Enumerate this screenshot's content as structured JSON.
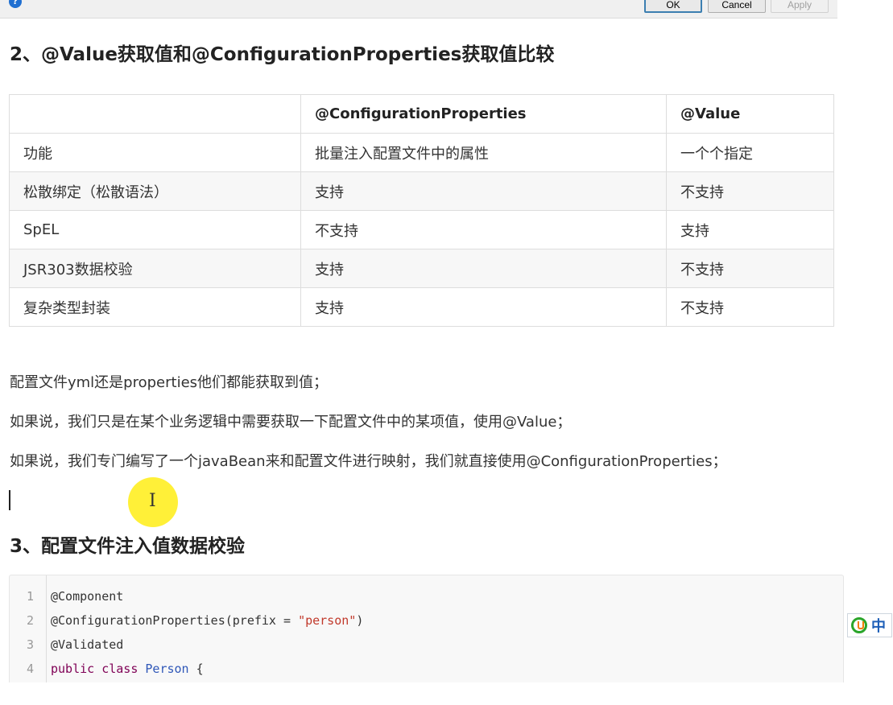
{
  "dialog": {
    "ok_label": "OK",
    "cancel_label": "Cancel",
    "apply_label": "Apply"
  },
  "section2": {
    "heading": "2、@Value获取值和@ConfigurationProperties获取值比较"
  },
  "comparison_table": {
    "headers": [
      "",
      "@ConfigurationProperties",
      "@Value"
    ],
    "rows": [
      [
        "功能",
        "批量注入配置文件中的属性",
        "一个个指定"
      ],
      [
        "松散绑定（松散语法）",
        "支持",
        "不支持"
      ],
      [
        "SpEL",
        "不支持",
        "支持"
      ],
      [
        "JSR303数据校验",
        "支持",
        "不支持"
      ],
      [
        "复杂类型封装",
        "支持",
        "不支持"
      ]
    ]
  },
  "paragraphs": [
    "配置文件yml还是properties他们都能获取到值；",
    "如果说，我们只是在某个业务逻辑中需要获取一下配置文件中的某项值，使用@Value；",
    "如果说，我们专门编写了一个javaBean来和配置文件进行映射，我们就直接使用@ConfigurationProperties；"
  ],
  "section3": {
    "heading": "3、配置文件注入值数据校验"
  },
  "code": {
    "line_numbers": [
      "1",
      "2",
      "3",
      "4"
    ],
    "l1": "@Component",
    "l2a": "@ConfigurationProperties(",
    "l2b": "prefix = ",
    "l2c": "\"person\"",
    "l2d": ")",
    "l3": "@Validated",
    "l4a": "public class ",
    "l4b": "Person",
    "l4c": " {"
  },
  "ime": {
    "lang": "中",
    "icon": "ime-logo-icon"
  },
  "colors": {
    "keyword": "#7f0055",
    "class_name": "#2f57b8",
    "string": "#c1392b",
    "cursor_highlight": "#ffee22"
  }
}
